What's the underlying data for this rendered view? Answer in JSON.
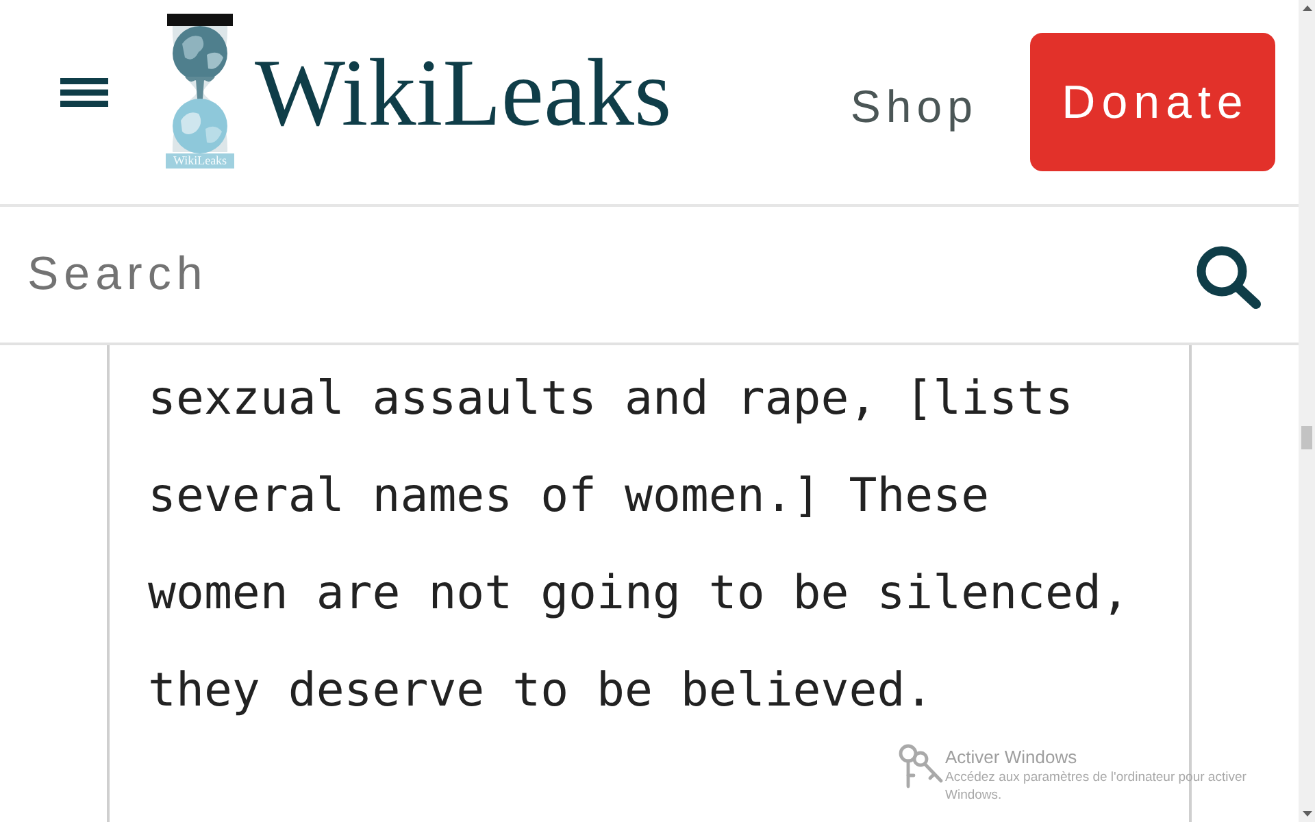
{
  "header": {
    "logo": {
      "caption": "WikiLeaks"
    },
    "site_name": "WikiLeaks",
    "links": [
      {
        "label": "Shop",
        "kind": "link"
      },
      {
        "label": "Donate",
        "kind": "button"
      }
    ]
  },
  "search": {
    "placeholder": "Search"
  },
  "article": {
    "text": "sexzual assaults and rape, [lists several names of women.] These women are not going to be silenced, they deserve to be believed."
  },
  "os_overlay": {
    "title": "Activer Windows",
    "message": "Accédez aux paramètres de l'ordinateur pour activer Windows."
  }
}
